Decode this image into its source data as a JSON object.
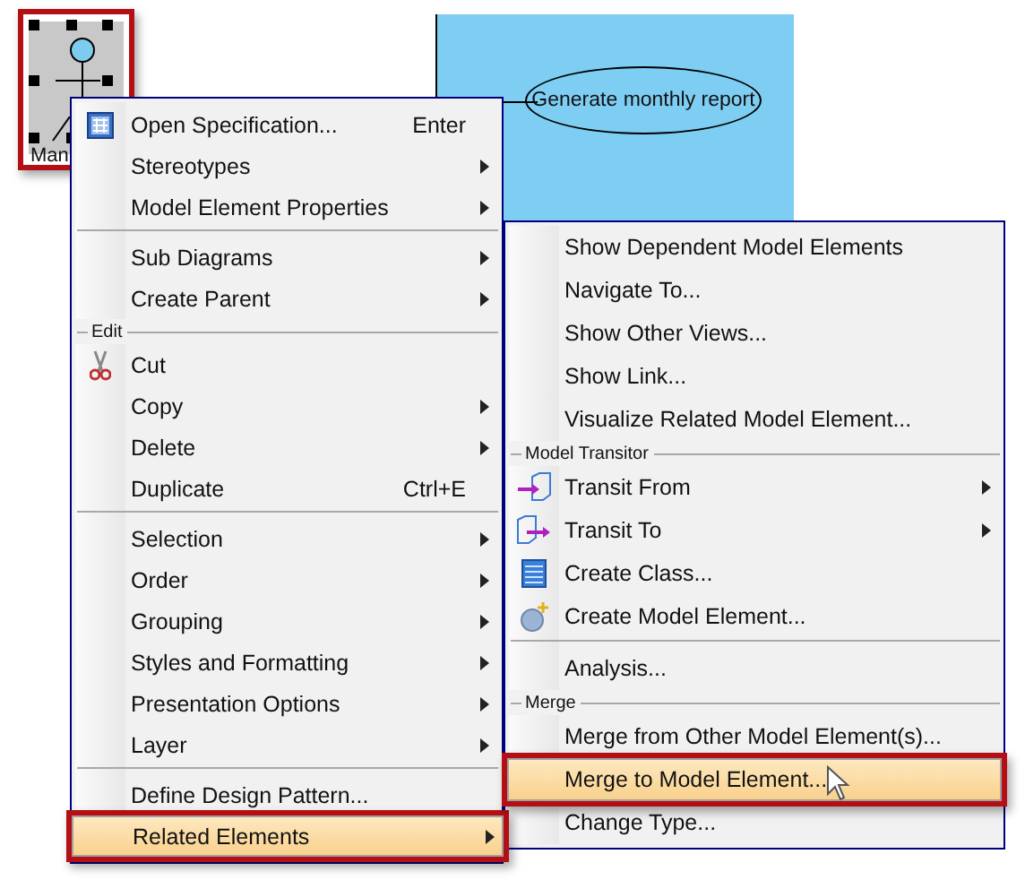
{
  "canvas": {
    "actor": {
      "label": "Man",
      "highlighted": true
    },
    "use_case": {
      "label": "Generate monthly report"
    }
  },
  "context_menu": {
    "entries": [
      {
        "kind": "item",
        "label": "Open Specification...",
        "shortcut": "Enter",
        "has_submenu": false,
        "selected": false
      },
      {
        "kind": "item",
        "label": "Stereotypes",
        "has_submenu": true,
        "selected": false
      },
      {
        "kind": "item",
        "label": "Model Element Properties",
        "has_submenu": true,
        "selected": false
      },
      {
        "kind": "separator"
      },
      {
        "kind": "item",
        "label": "Sub Diagrams",
        "has_submenu": true,
        "selected": false
      },
      {
        "kind": "item",
        "label": "Create Parent",
        "has_submenu": true,
        "selected": false
      },
      {
        "kind": "header",
        "label": "Edit"
      },
      {
        "kind": "item",
        "label": "Cut",
        "has_submenu": false,
        "selected": false
      },
      {
        "kind": "item",
        "label": "Copy",
        "has_submenu": true,
        "selected": false
      },
      {
        "kind": "item",
        "label": "Delete",
        "has_submenu": true,
        "selected": false
      },
      {
        "kind": "item",
        "label": "Duplicate",
        "shortcut": "Ctrl+E",
        "has_submenu": false,
        "selected": false
      },
      {
        "kind": "separator"
      },
      {
        "kind": "item",
        "label": "Selection",
        "has_submenu": true,
        "selected": false
      },
      {
        "kind": "item",
        "label": "Order",
        "has_submenu": true,
        "selected": false
      },
      {
        "kind": "item",
        "label": "Grouping",
        "has_submenu": true,
        "selected": false
      },
      {
        "kind": "item",
        "label": "Styles and Formatting",
        "has_submenu": true,
        "selected": false
      },
      {
        "kind": "item",
        "label": "Presentation Options",
        "has_submenu": true,
        "selected": false
      },
      {
        "kind": "item",
        "label": "Layer",
        "has_submenu": true,
        "selected": false
      },
      {
        "kind": "separator"
      },
      {
        "kind": "item",
        "label": "Define Design Pattern...",
        "has_submenu": false,
        "selected": false
      },
      {
        "kind": "item",
        "label": "Related Elements",
        "has_submenu": true,
        "selected": true
      }
    ]
  },
  "submenu": {
    "entries": [
      {
        "kind": "item",
        "label": "Show Dependent Model Elements",
        "has_submenu": false,
        "selected": false
      },
      {
        "kind": "item",
        "label": "Navigate To...",
        "has_submenu": false,
        "selected": false
      },
      {
        "kind": "item",
        "label": "Show Other Views...",
        "has_submenu": false,
        "selected": false
      },
      {
        "kind": "item",
        "label": "Show Link...",
        "has_submenu": false,
        "selected": false
      },
      {
        "kind": "item",
        "label": "Visualize Related Model Element...",
        "has_submenu": false,
        "selected": false
      },
      {
        "kind": "header",
        "label": "Model Transitor"
      },
      {
        "kind": "item",
        "label": "Transit From",
        "has_submenu": true,
        "selected": false
      },
      {
        "kind": "item",
        "label": "Transit To",
        "has_submenu": true,
        "selected": false
      },
      {
        "kind": "item",
        "label": "Create Class...",
        "has_submenu": false,
        "selected": false
      },
      {
        "kind": "item",
        "label": "Create Model Element...",
        "has_submenu": false,
        "selected": false
      },
      {
        "kind": "separator"
      },
      {
        "kind": "item",
        "label": "Analysis...",
        "has_submenu": false,
        "selected": false
      },
      {
        "kind": "header",
        "label": "Merge"
      },
      {
        "kind": "item",
        "label": "Merge from Other Model Element(s)...",
        "has_submenu": false,
        "selected": false
      },
      {
        "kind": "item",
        "label": "Merge to Model Element...",
        "has_submenu": false,
        "selected": true
      },
      {
        "kind": "item",
        "label": "Change Type...",
        "has_submenu": false,
        "selected": false
      }
    ]
  }
}
